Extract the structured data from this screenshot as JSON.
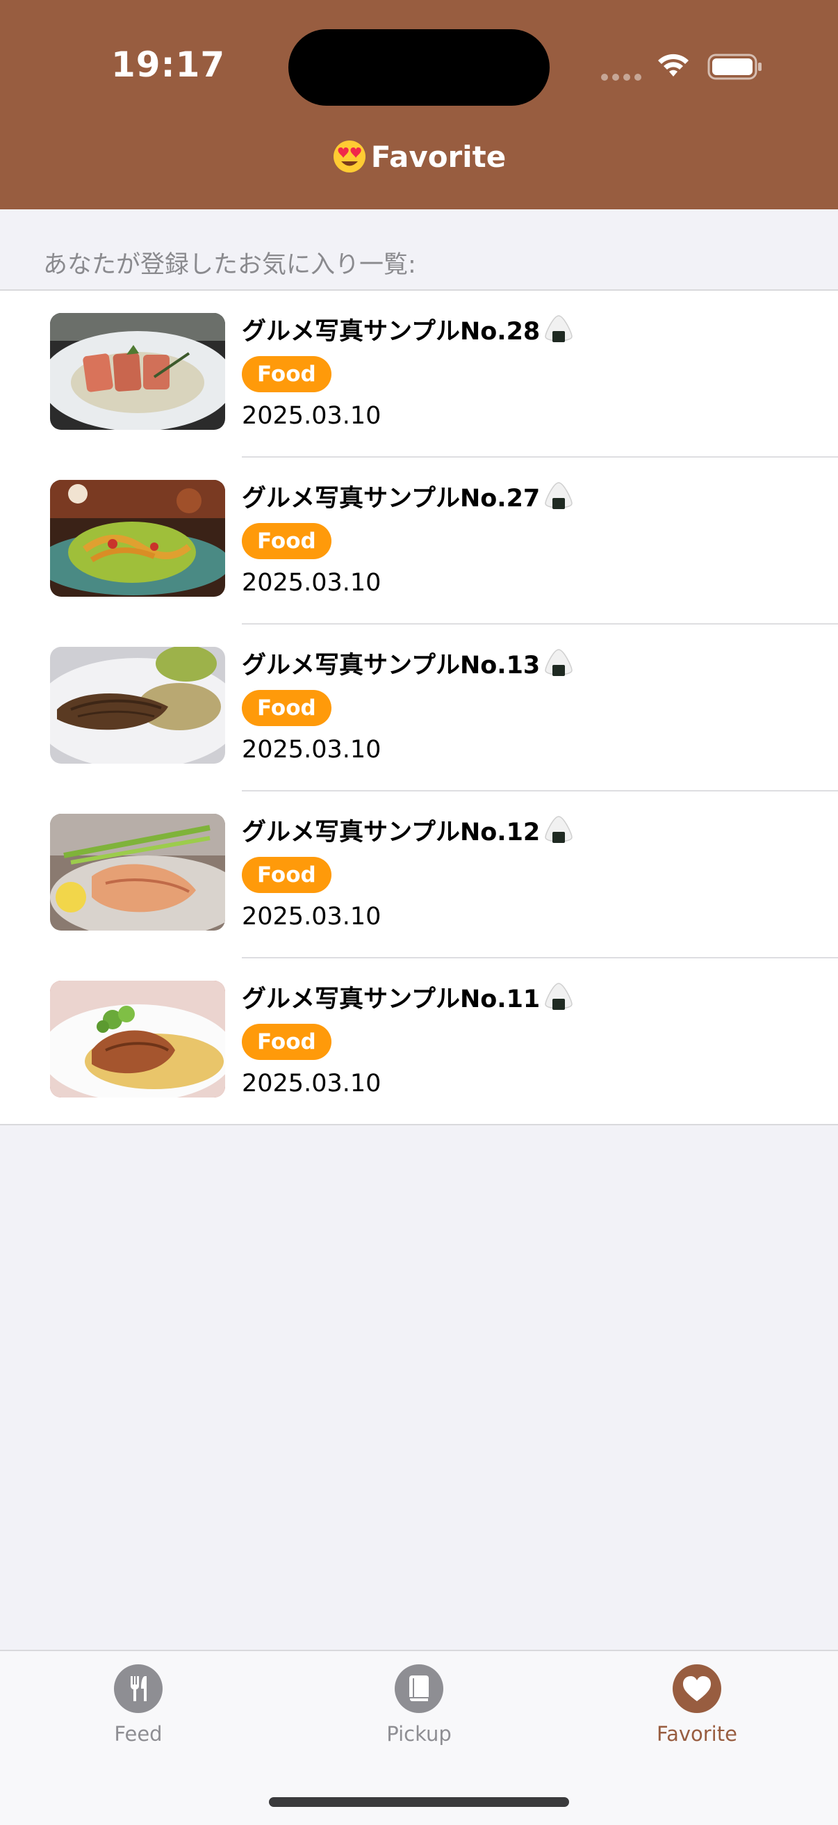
{
  "status_bar": {
    "time": "19:17"
  },
  "nav": {
    "title": "Favorite",
    "title_emoji": "heart-eyes-emoji"
  },
  "section": {
    "header": "あなたが登録したお気に入り一覧:"
  },
  "items": [
    {
      "title": "グルメ写真サンプルNo.28",
      "tag": "Food",
      "date": "2025.03.10",
      "image": "salmon-fillet-photo"
    },
    {
      "title": "グルメ写真サンプルNo.27",
      "tag": "Food",
      "date": "2025.03.10",
      "image": "noodle-salad-photo"
    },
    {
      "title": "グルメ写真サンプルNo.13",
      "tag": "Food",
      "date": "2025.03.10",
      "image": "grilled-fish-photo"
    },
    {
      "title": "グルメ写真サンプルNo.12",
      "tag": "Food",
      "date": "2025.03.10",
      "image": "salmon-steak-photo"
    },
    {
      "title": "グルメ写真サンプルNo.11",
      "tag": "Food",
      "date": "2025.03.10",
      "image": "chicken-plate-photo"
    }
  ],
  "tabbar": {
    "tabs": [
      {
        "label": "Feed",
        "icon": "fork-knife-icon",
        "active": false
      },
      {
        "label": "Pickup",
        "icon": "book-icon",
        "active": false
      },
      {
        "label": "Favorite",
        "icon": "heart-icon",
        "active": true
      }
    ]
  },
  "colors": {
    "header_bg": "#985d40",
    "badge_bg": "#ff9a0a",
    "active_tab": "#985d40",
    "inactive_tab": "#8e8e93"
  }
}
